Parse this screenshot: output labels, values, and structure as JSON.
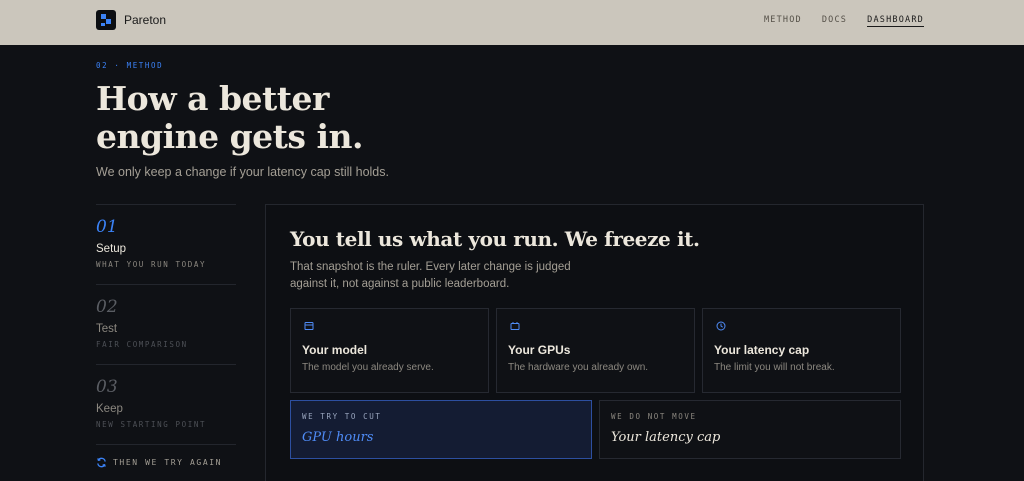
{
  "brand": {
    "name": "Pareton"
  },
  "nav": [
    {
      "label": "METHOD"
    },
    {
      "label": "DOCS"
    },
    {
      "label": "DASHBOARD"
    }
  ],
  "hero": {
    "eyebrow": "02 · METHOD",
    "title": "How a better engine gets in.",
    "subtitle": "We only keep a change if your latency cap still holds."
  },
  "steps": [
    {
      "num": "01",
      "title": "Setup",
      "sub": "WHAT YOU RUN TODAY",
      "active": true
    },
    {
      "num": "02",
      "title": "Test",
      "sub": "FAIR COMPARISON",
      "active": false
    },
    {
      "num": "03",
      "title": "Keep",
      "sub": "NEW STARTING POINT",
      "active": false
    }
  ],
  "loop_label": "THEN WE TRY AGAIN",
  "panel": {
    "title": "You tell us what you run. We freeze it.",
    "description": "That snapshot is the ruler. Every later change is judged against it, not against a public leaderboard.",
    "cards": [
      {
        "icon": "model-icon",
        "title": "Your model",
        "desc": "The model you already serve."
      },
      {
        "icon": "gpu-icon",
        "title": "Your GPUs",
        "desc": "The hardware you already own."
      },
      {
        "icon": "clock-icon",
        "title": "Your latency cap",
        "desc": "The limit you will not break."
      }
    ],
    "targets": [
      {
        "label": "WE TRY TO CUT",
        "value": "GPU hours"
      },
      {
        "label": "WE DO NOT MOVE",
        "value": "Your latency cap"
      }
    ]
  },
  "colors": {
    "accent": "#3b82f6",
    "topbar": "#cbc6bc",
    "background": "#0f1115"
  }
}
